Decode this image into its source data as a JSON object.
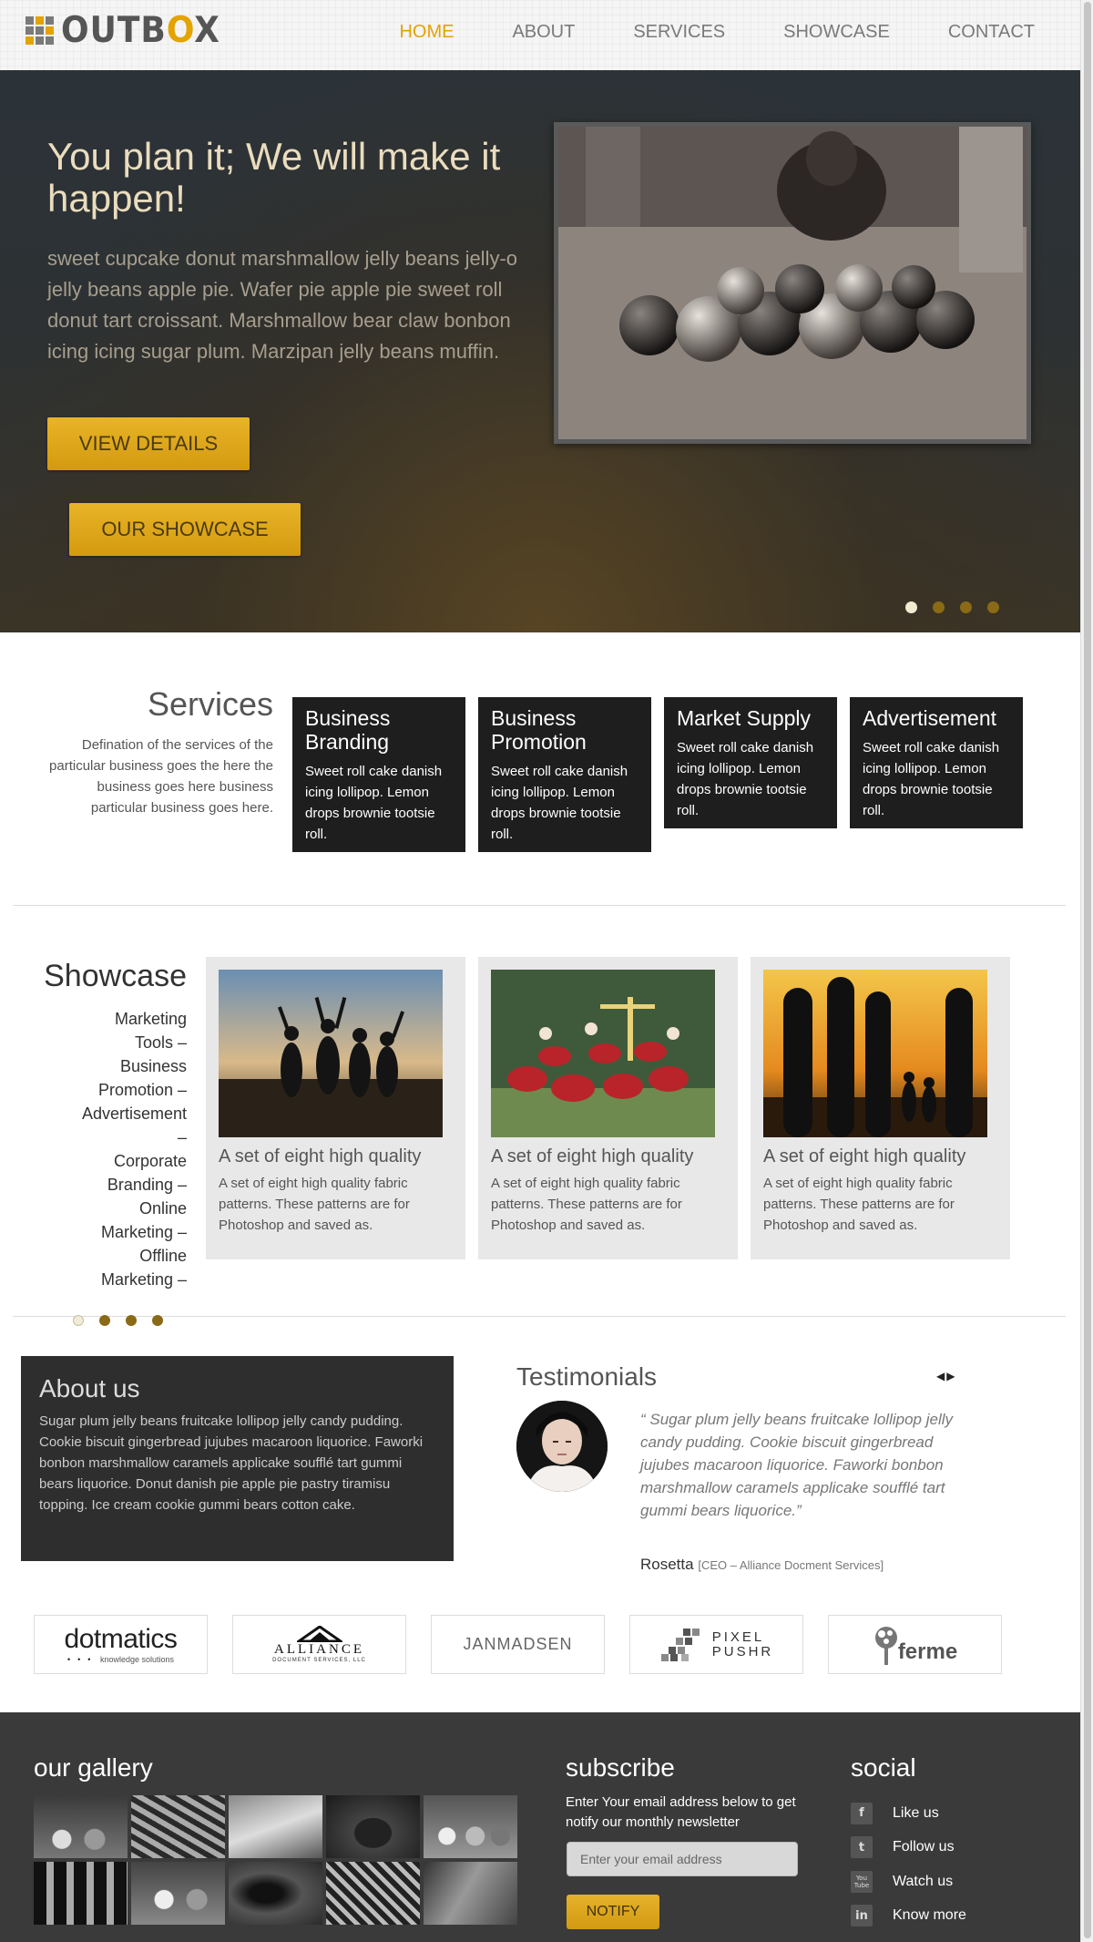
{
  "header": {
    "logo_text_a": "OUTB",
    "logo_text_ring": "O",
    "logo_text_b": "X",
    "nav": [
      "HOME",
      "ABOUT",
      "SERVICES",
      "SHOWCASE",
      "CONTACT"
    ],
    "active_nav": "HOME"
  },
  "hero": {
    "title": "You plan it; We will make it happen!",
    "text": "sweet cupcake donut marshmallow jelly beans jelly-o jelly beans apple pie. Wafer pie apple pie sweet roll donut tart croissant. Marshmallow bear claw bonbon icing icing sugar plum. Marzipan jelly beans muffin.",
    "btn_view": "VIEW DETAILS",
    "btn_showcase": "OUR SHOWCASE",
    "slide_count": 4,
    "active_slide": 1
  },
  "services": {
    "title": "Services",
    "description": "Defination of the services of the particular business goes the here the business goes here business particular business goes here.",
    "cards": [
      {
        "title": "Business Branding",
        "text": "Sweet roll cake danish icing lollipop. Lemon drops brownie tootsie roll."
      },
      {
        "title": "Business Promotion",
        "text": "Sweet roll cake danish icing lollipop. Lemon drops brownie tootsie roll."
      },
      {
        "title": "Market Supply",
        "text": "Sweet roll cake danish icing lollipop. Lemon drops brownie tootsie roll."
      },
      {
        "title": "Advertisement",
        "text": "Sweet roll cake danish icing lollipop. Lemon drops brownie tootsie roll."
      }
    ]
  },
  "showcase": {
    "title": "Showcase",
    "list": [
      "Marketing",
      "Tools –",
      "Business",
      "Promotion –",
      "Advertisement",
      "–",
      "Corporate",
      "Branding –",
      "Online",
      "Marketing –",
      "Offline",
      "Marketing –"
    ],
    "cards": [
      {
        "title": "A set of eight high quality",
        "text": "A set of eight high quality fabric patterns. These patterns are for Photoshop and saved as."
      },
      {
        "title": "A set of eight high quality",
        "text": "A set of eight high quality fabric patterns. These patterns are for Photoshop and saved as."
      },
      {
        "title": "A set of eight high quality",
        "text": "A set of eight high quality fabric patterns. These patterns are for Photoshop and saved as."
      }
    ]
  },
  "about": {
    "title": "About us",
    "text": "Sugar plum jelly beans fruitcake lollipop jelly candy pudding. Cookie biscuit gingerbread jujubes macaroon liquorice. Faworki bonbon marshmallow caramels applicake soufflé tart gummi bears liquorice. Donut danish pie apple pie pastry tiramisu topping. Ice cream cookie gummi bears cotton cake."
  },
  "testimonials": {
    "title": "Testimonials",
    "quote": "“ Sugar plum jelly beans fruitcake lollipop jelly candy pudding. Cookie biscuit gingerbread jujubes macaroon liquorice. Faworki bonbon marshmallow caramels applicake soufflé tart gummi bears liquorice.”",
    "author": "Rosetta",
    "author_role": "[CEO – Alliance Docment Services]"
  },
  "clients": {
    "dotmatics": "dotmatics",
    "dotmatics_tag": "knowledge solutions",
    "alliance": "ALLIANCE",
    "alliance_tag": "DOCUMENT SERVICES, LLC",
    "janmadsen": "JANMADSEN",
    "pixel": "PIXEL",
    "pushr": "PUSHR",
    "ferme": "ferme"
  },
  "footer": {
    "gallery_title": "our gallery",
    "subscribe_title": "subscribe",
    "subscribe_text": "Enter Your email address below to get notify our monthly newsletter",
    "email_placeholder": "Enter your email address",
    "notify_label": "NOTIFY",
    "social_title": "social",
    "social": [
      {
        "icon": "f",
        "label": "Like us"
      },
      {
        "icon": "t",
        "label": "Follow us"
      },
      {
        "icon": "You Tube",
        "label": "Watch us"
      },
      {
        "icon": "in",
        "label": "Know more"
      }
    ]
  }
}
